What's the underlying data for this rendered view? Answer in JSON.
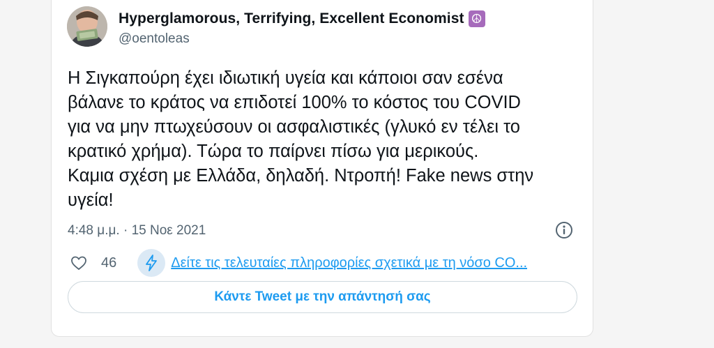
{
  "tweet": {
    "author": {
      "display_name": "Hyperglamorous, Terrifying, Excellent Economist",
      "badge_emoji": "☮",
      "handle": "@oentoleas",
      "avatar_icon": "profile-photo-icon"
    },
    "text": "Η Σιγκαπούρη έχει ιδιωτική υγεία και κάποιοι σαν εσένα\nβάλανε το κράτος να επιδοτεί 100% το κόστος του COVID\nγια να μην πτωχεύσουν οι ασφαλιστικές (γλυκό εν τέλει το\nκρατικό χρήμα). Τώρα το παίρνει πίσω για μερικούς.\nΚαμια σχέση με Ελλάδα, δηλαδή. Ντροπή! Fake news στην\nυγεία!",
    "timestamp": "4:48 μ.μ. · 15 Νοε 2021",
    "likes": "46",
    "covid_link": "Δείτε τις τελευταίες πληροφορίες σχετικά με τη νόσο CO...",
    "reply_label": "Κάντε Tweet με την απάντησή σας"
  },
  "colors": {
    "accent": "#1d9bf0",
    "secondary_text": "#536471",
    "badge": "#a66bbb",
    "background": "#f5f5f5"
  }
}
